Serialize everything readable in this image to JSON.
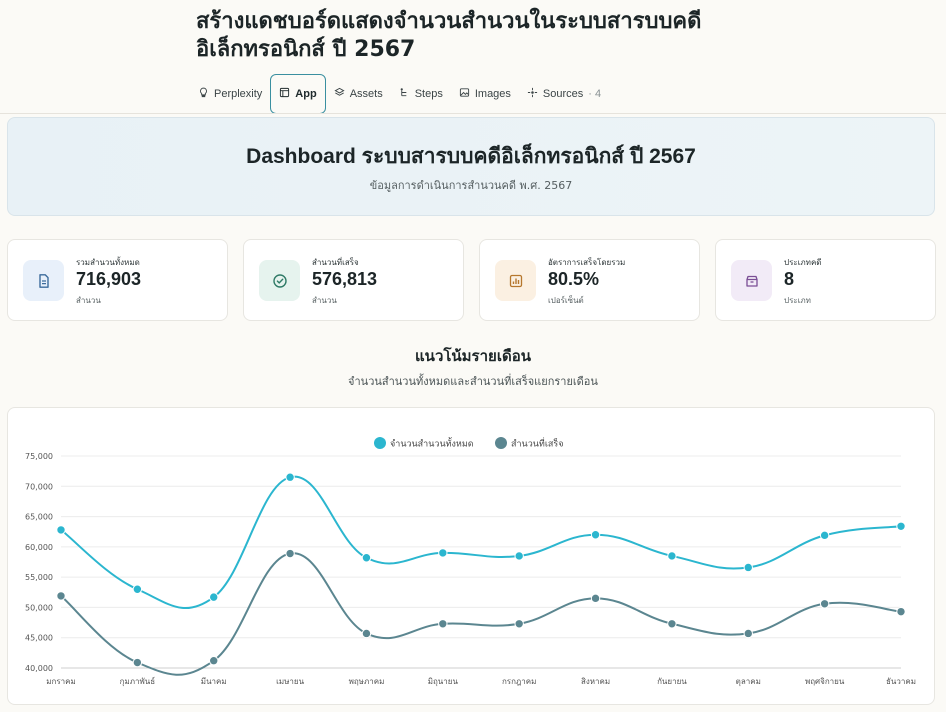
{
  "page": {
    "title": "สร้างแดชบอร์ดแสดงจำนวนสำนวนในระบบสารบบคดีอิเล็กทรอนิกส์ ปี 2567"
  },
  "tabs": [
    {
      "label": "Perplexity",
      "icon": "lightbulb-icon"
    },
    {
      "label": "App",
      "icon": "app-window-icon",
      "active": true
    },
    {
      "label": "Assets",
      "icon": "layers-icon"
    },
    {
      "label": "Steps",
      "icon": "steps-icon"
    },
    {
      "label": "Images",
      "icon": "image-icon"
    },
    {
      "label": "Sources",
      "icon": "sources-icon",
      "count": "· 4"
    }
  ],
  "hero": {
    "title": "Dashboard ระบบสารบบคดีอิเล็กทรอนิกส์ ปี 2567",
    "subtitle": "ข้อมูลการดำเนินการสำนวนคดี พ.ศ. 2567"
  },
  "cards": [
    {
      "label": "รวมสำนวนทั้งหมด",
      "value": "716,903",
      "unit": "สำนวน",
      "icon": "document-icon",
      "bg": "#e8f0fa",
      "fg": "#3d6c9c"
    },
    {
      "label": "สำนวนที่เสร็จ",
      "value": "576,813",
      "unit": "สำนวน",
      "icon": "check-circle-icon",
      "bg": "#e6f3ee",
      "fg": "#2f7a66"
    },
    {
      "label": "อัตราการเสร็จโดยรวม",
      "value": "80.5%",
      "unit": "เปอร์เซ็นต์",
      "icon": "bar-chart-icon",
      "bg": "#fbf0e2",
      "fg": "#b6772e"
    },
    {
      "label": "ประเภทคดี",
      "value": "8",
      "unit": "ประเภท",
      "icon": "archive-icon",
      "bg": "#f2ebf7",
      "fg": "#7b4e95"
    }
  ],
  "section": {
    "title": "แนวโน้มรายเดือน",
    "subtitle": "จำนวนสำนวนทั้งหมดและสำนวนที่เสร็จแยกรายเดือน"
  },
  "chart_data": {
    "type": "line",
    "categories": [
      "มกราคม",
      "กุมภาพันธ์",
      "มีนาคม",
      "เมษายน",
      "พฤษภาคม",
      "มิถุนายน",
      "กรกฎาคม",
      "สิงหาคม",
      "กันยายน",
      "ตุลาคม",
      "พฤศจิกายน",
      "ธันวาคม"
    ],
    "series": [
      {
        "name": "จำนวนสำนวนทั้งหมด",
        "color": "#2bb6cf",
        "values": [
          62800,
          53000,
          51700,
          71500,
          58200,
          59000,
          58500,
          62000,
          58500,
          56600,
          61900,
          63400
        ]
      },
      {
        "name": "สำนวนที่เสร็จ",
        "color": "#5b8690",
        "values": [
          51900,
          40900,
          41200,
          58900,
          45700,
          47300,
          47300,
          51500,
          47300,
          45700,
          50600,
          49300
        ]
      }
    ],
    "ylim": [
      40000,
      75000
    ],
    "yticks": [
      "40,000",
      "45,000",
      "50,000",
      "55,000",
      "60,000",
      "65,000",
      "70,000",
      "75,000"
    ],
    "ytick_values": [
      40000,
      45000,
      50000,
      55000,
      60000,
      65000,
      70000,
      75000
    ],
    "grid": true,
    "legend": "top-center",
    "smooth": true
  }
}
